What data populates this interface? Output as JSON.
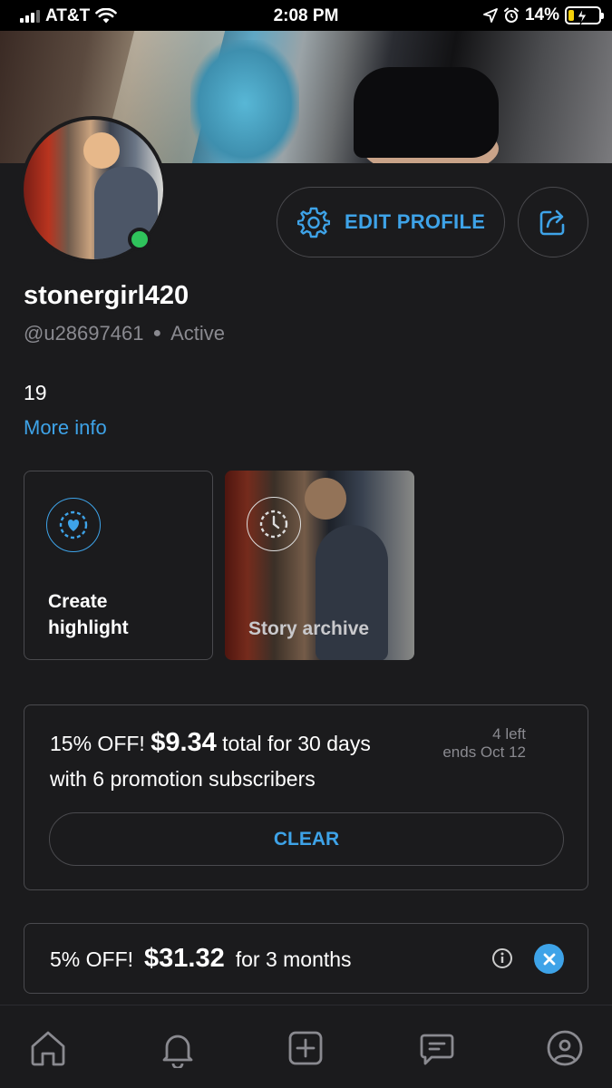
{
  "status_bar": {
    "carrier": "AT&T",
    "time": "2:08 PM",
    "battery": "14%"
  },
  "profile": {
    "display_name": "stonergirl420",
    "handle": "@u28697461",
    "status": "Active",
    "bio": "19",
    "more_info_label": "More info",
    "edit_profile_label": "EDIT PROFILE"
  },
  "highlights": {
    "create_label": "Create highlight",
    "archive_label": "Story archive"
  },
  "promotions": [
    {
      "discount": "15% OFF!",
      "price": "$9.34",
      "term": "total for 30 days",
      "detail": "with 6 promotion subscribers",
      "left": "4 left",
      "ends": "ends Oct 12",
      "action_label": "CLEAR"
    },
    {
      "discount": "5% OFF!",
      "price": "$31.32",
      "term": "for 3 months"
    }
  ],
  "nav": {
    "items": [
      "home-icon",
      "bell-icon",
      "plus-square-icon",
      "chat-icon",
      "user-circle-icon"
    ]
  },
  "colors": {
    "accent": "#3ea3e8",
    "background": "#1b1b1d",
    "online": "#2fc35c",
    "muted": "#8a8a90",
    "border": "#4a4a4e"
  }
}
